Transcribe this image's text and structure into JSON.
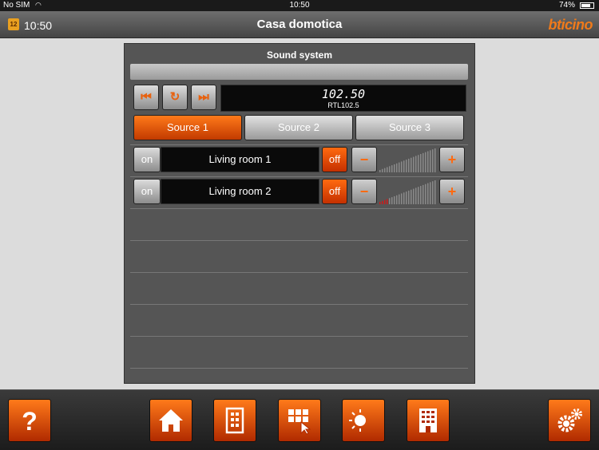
{
  "status_bar": {
    "carrier": "No SIM",
    "time": "10:50",
    "battery": "74%"
  },
  "header": {
    "calendar_day": "12",
    "clock": "10:50",
    "title": "Casa domotica",
    "logo": "bticino"
  },
  "panel": {
    "title": "Sound system",
    "tuner": {
      "frequency": "102.50",
      "station": "RTL102.5"
    },
    "sources": [
      {
        "label": "Source 1",
        "active": true
      },
      {
        "label": "Source 2",
        "active": false
      },
      {
        "label": "Source 3",
        "active": false
      }
    ],
    "zones": [
      {
        "on_label": "on",
        "name": "Living room 1",
        "off_label": "off",
        "volume_level": 0.0
      },
      {
        "on_label": "on",
        "name": "Living room 2",
        "off_label": "off",
        "volume_level": 0.15
      }
    ]
  },
  "bottom_nav": {
    "items": [
      "help-icon",
      "home-icon",
      "door-icon",
      "keypad-icon",
      "sun-moon-icon",
      "building-icon",
      "settings-icon"
    ]
  },
  "colors": {
    "accent": "#ff6a10",
    "panel": "#555555",
    "background": "#dcdcdc"
  }
}
